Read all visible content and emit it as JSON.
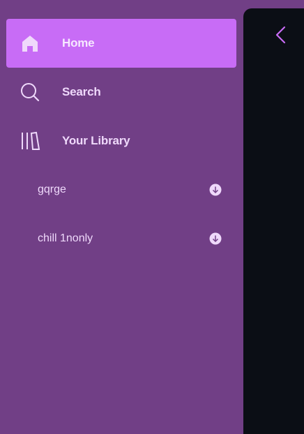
{
  "sidebar": {
    "nav": [
      {
        "label": "Home",
        "icon": "home-icon",
        "active": true
      },
      {
        "label": "Search",
        "icon": "search-icon",
        "active": false
      },
      {
        "label": "Your Library",
        "icon": "library-icon",
        "active": false
      }
    ],
    "playlists": [
      {
        "name": "gqrge",
        "icon": "download-icon"
      },
      {
        "name": "chill 1nonly",
        "icon": "download-icon"
      }
    ]
  },
  "colors": {
    "sidebar_bg": "#713f86",
    "active_bg": "#c86cf6",
    "panel_bg": "#0b0e15",
    "accent": "#c86cf6",
    "text": "#efd9fb"
  }
}
